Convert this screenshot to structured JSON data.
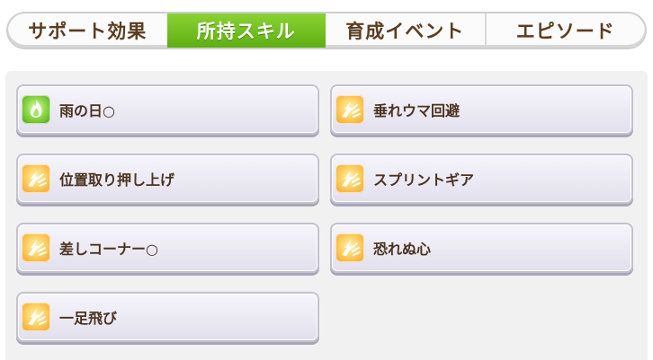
{
  "tabs": [
    {
      "label": "サポート効果",
      "active": false
    },
    {
      "label": "所持スキル",
      "active": true
    },
    {
      "label": "育成イベント",
      "active": false
    },
    {
      "label": "エピソード",
      "active": false
    }
  ],
  "skills": [
    {
      "name": "雨の日○",
      "icon": "green-flame-skill-icon"
    },
    {
      "name": "垂れウマ回避",
      "icon": "gold-speed-skill-icon"
    },
    {
      "name": "位置取り押し上げ",
      "icon": "gold-speed-skill-icon"
    },
    {
      "name": "スプリントギア",
      "icon": "gold-speed-skill-icon"
    },
    {
      "name": "差しコーナー○",
      "icon": "gold-speed-skill-icon"
    },
    {
      "name": "恐れぬ心",
      "icon": "gold-speed-skill-icon"
    },
    {
      "name": "一足飛び",
      "icon": "gold-speed-skill-icon"
    }
  ],
  "colors": {
    "active_tab": "#6cbf1c",
    "tab_text": "#5a3d21",
    "skill_text": "#4a3320"
  }
}
